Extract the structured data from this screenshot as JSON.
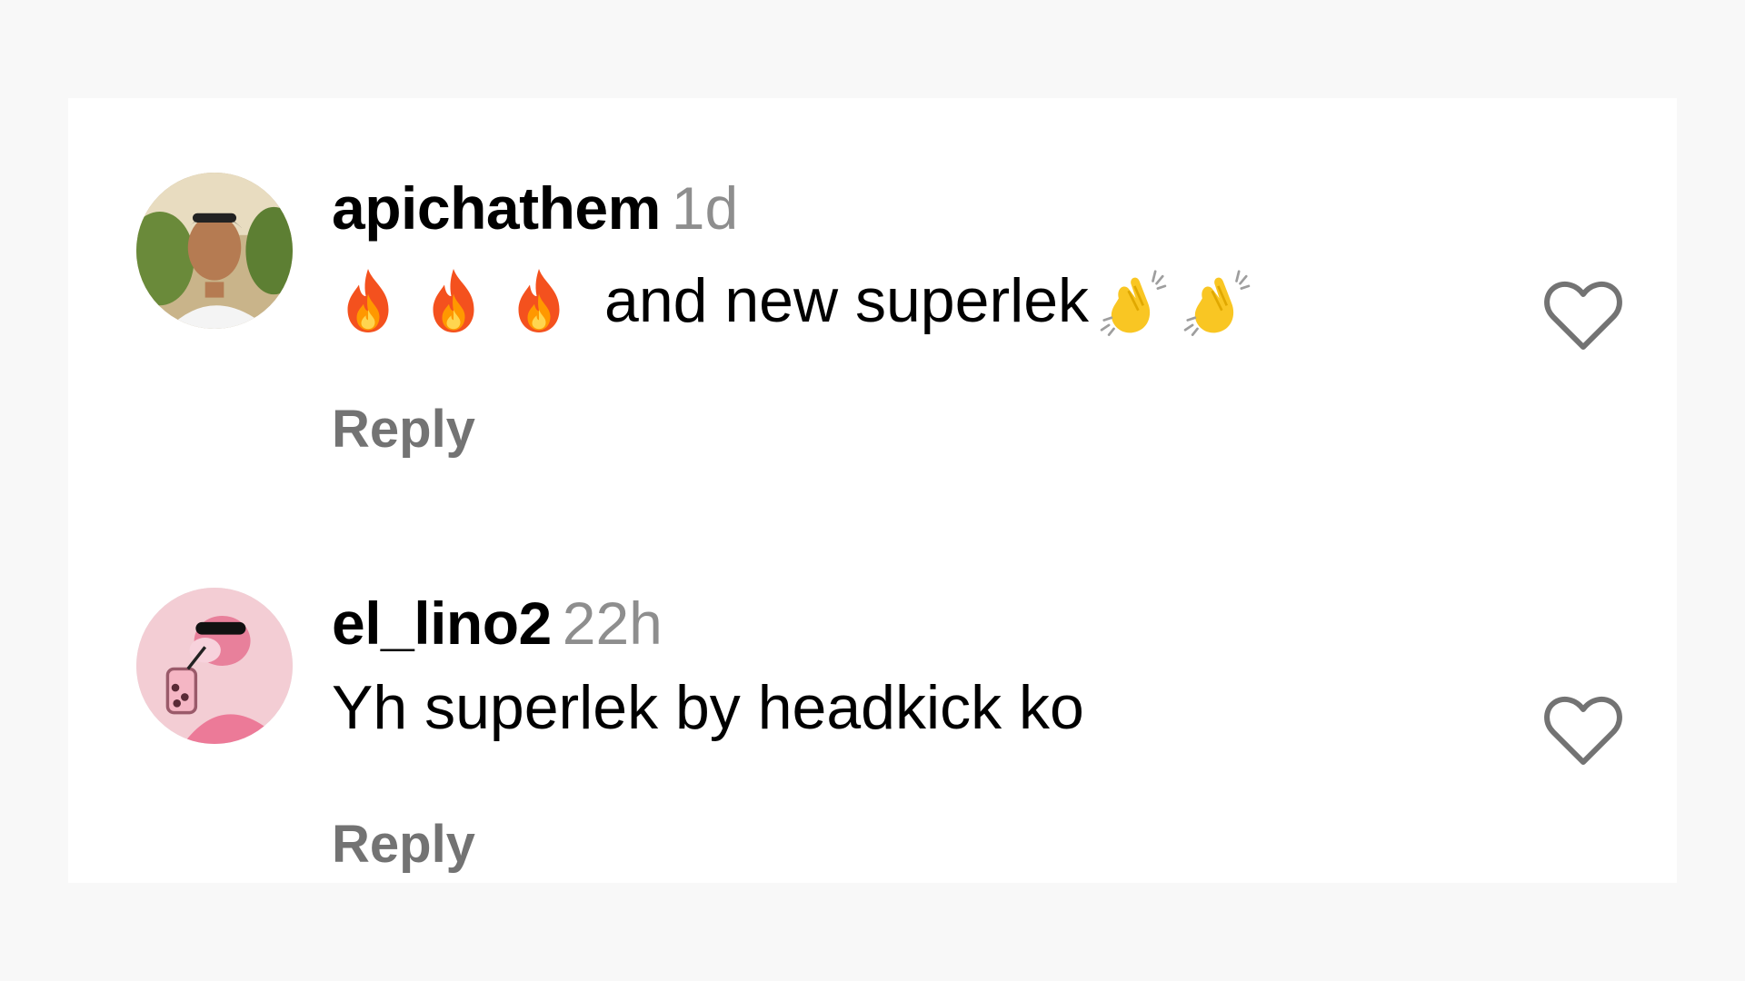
{
  "comments": [
    {
      "username": "apichathem",
      "time": "1d",
      "text": "and new superlek",
      "leading_emoji": [
        "fire-icon",
        "fire-icon",
        "fire-icon"
      ],
      "trailing_emoji": [
        "clapping-hands-icon",
        "clapping-hands-icon"
      ],
      "reply_label": "Reply",
      "like_icon": "heart-outline-icon"
    },
    {
      "username": "el_lino2",
      "time": "22h",
      "text": "Yh superlek by headkick ko",
      "reply_label": "Reply",
      "like_icon": "heart-outline-icon"
    }
  ],
  "colors": {
    "background": "#f8f8f8",
    "panel": "#ffffff",
    "username": "#000000",
    "timestamp": "#8e8e8e",
    "reply": "#737373",
    "heart_stroke": "#737373"
  }
}
